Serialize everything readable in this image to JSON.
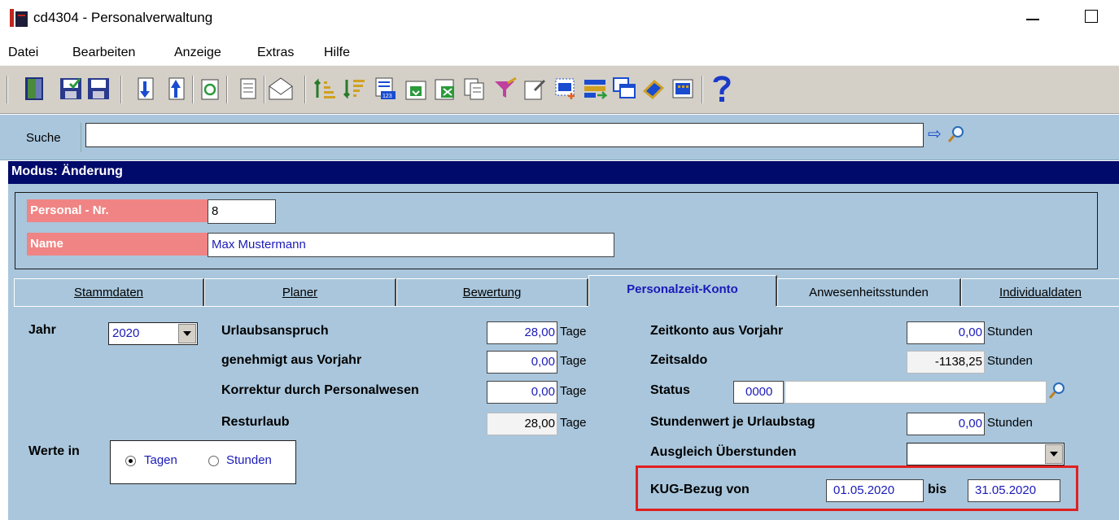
{
  "window": {
    "title": "cd4304 - Personalverwaltung"
  },
  "menu": [
    "Datei",
    "Bearbeiten",
    "Anzeige",
    "Extras",
    "Hilfe"
  ],
  "search": {
    "label": "Suche",
    "value": ""
  },
  "mode": "Modus: Änderung",
  "header": {
    "personal_nr_label": "Personal - Nr.",
    "personal_nr_value": "8",
    "name_label": "Name",
    "name_value": "Max Mustermann"
  },
  "tabs": [
    {
      "label": "Stammdaten",
      "active": false
    },
    {
      "label": "Planer",
      "active": false
    },
    {
      "label": "Bewertung",
      "active": false
    },
    {
      "label": "Personalzeit-Konto",
      "active": true
    },
    {
      "label": "Anwesenheitsstunden",
      "active": false
    },
    {
      "label": "Individualdaten",
      "active": false
    }
  ],
  "form": {
    "jahr_label": "Jahr",
    "jahr_value": "2020",
    "urlaubsanspruch_label": "Urlaubsanspruch",
    "urlaubsanspruch_value": "28,00",
    "genehmigt_label": "genehmigt aus Vorjahr",
    "genehmigt_value": "0,00",
    "korrektur_label": "Korrektur durch Personalwesen",
    "korrektur_value": "0,00",
    "resturlaub_label": "Resturlaub",
    "resturlaub_value": "28,00",
    "unit_tage": "Tage",
    "werte_in_label": "Werte in",
    "radio_tagen": "Tagen",
    "radio_stunden": "Stunden",
    "radio_selected": "Tagen",
    "zeitkonto_label": "Zeitkonto aus Vorjahr",
    "zeitkonto_value": "0,00",
    "zeitsaldo_label": "Zeitsaldo",
    "zeitsaldo_value": "-1138,25",
    "status_label": "Status",
    "status_value": "0000",
    "stundenwert_label": "Stundenwert je Urlaubstag",
    "stundenwert_value": "0,00",
    "unit_stunden": "Stunden",
    "ausgleich_label": "Ausgleich Überstunden",
    "ausgleich_value": "",
    "kug_label": "KUG-Bezug von",
    "kug_from": "01.05.2020",
    "kug_bis_label": "bis",
    "kug_to": "31.05.2020"
  },
  "colors": {
    "panel_bg": "#a9c6dc",
    "mode_bar": "#000a6a",
    "label_pink": "#f08484",
    "highlight_red": "#e02020",
    "value_blue": "#1a1ab8"
  }
}
